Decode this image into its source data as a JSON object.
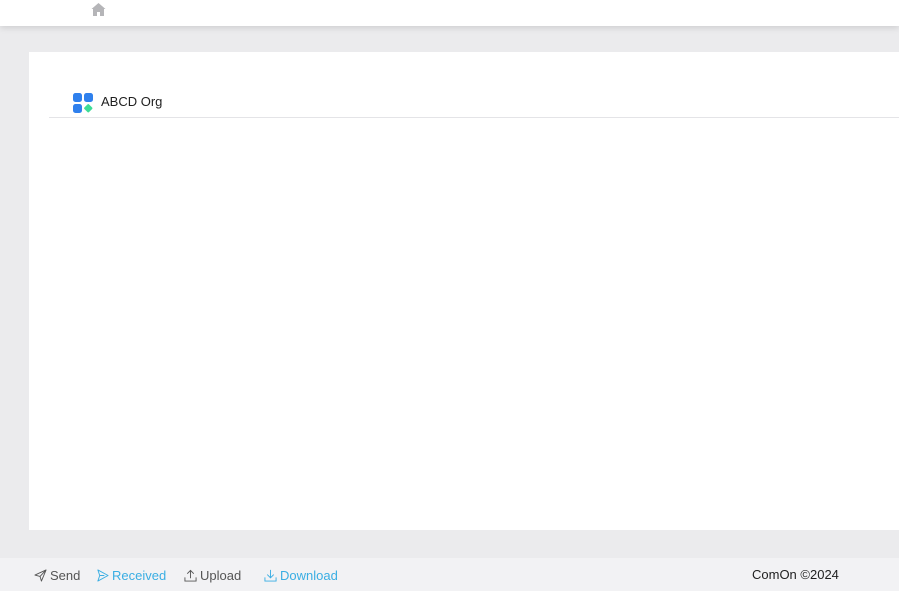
{
  "header": {
    "home_icon": "home-icon"
  },
  "org": {
    "icon": "apps-grid-icon",
    "name": "ABCD Org"
  },
  "footer_nav": {
    "items": [
      {
        "label": "Send",
        "icon": "paper-plane-icon",
        "active": false
      },
      {
        "label": "Received",
        "icon": "paper-plane-outline-icon",
        "active": true
      },
      {
        "label": "Upload",
        "icon": "upload-icon",
        "active": false
      },
      {
        "label": "Download",
        "icon": "download-icon",
        "active": true
      }
    ]
  },
  "footer": {
    "copyright": "ComOn ©2024"
  },
  "colors": {
    "accent": "#3aaee3",
    "icon_blue": "#2f80ed",
    "icon_green": "#3ddc97",
    "background": "#ebebed"
  }
}
